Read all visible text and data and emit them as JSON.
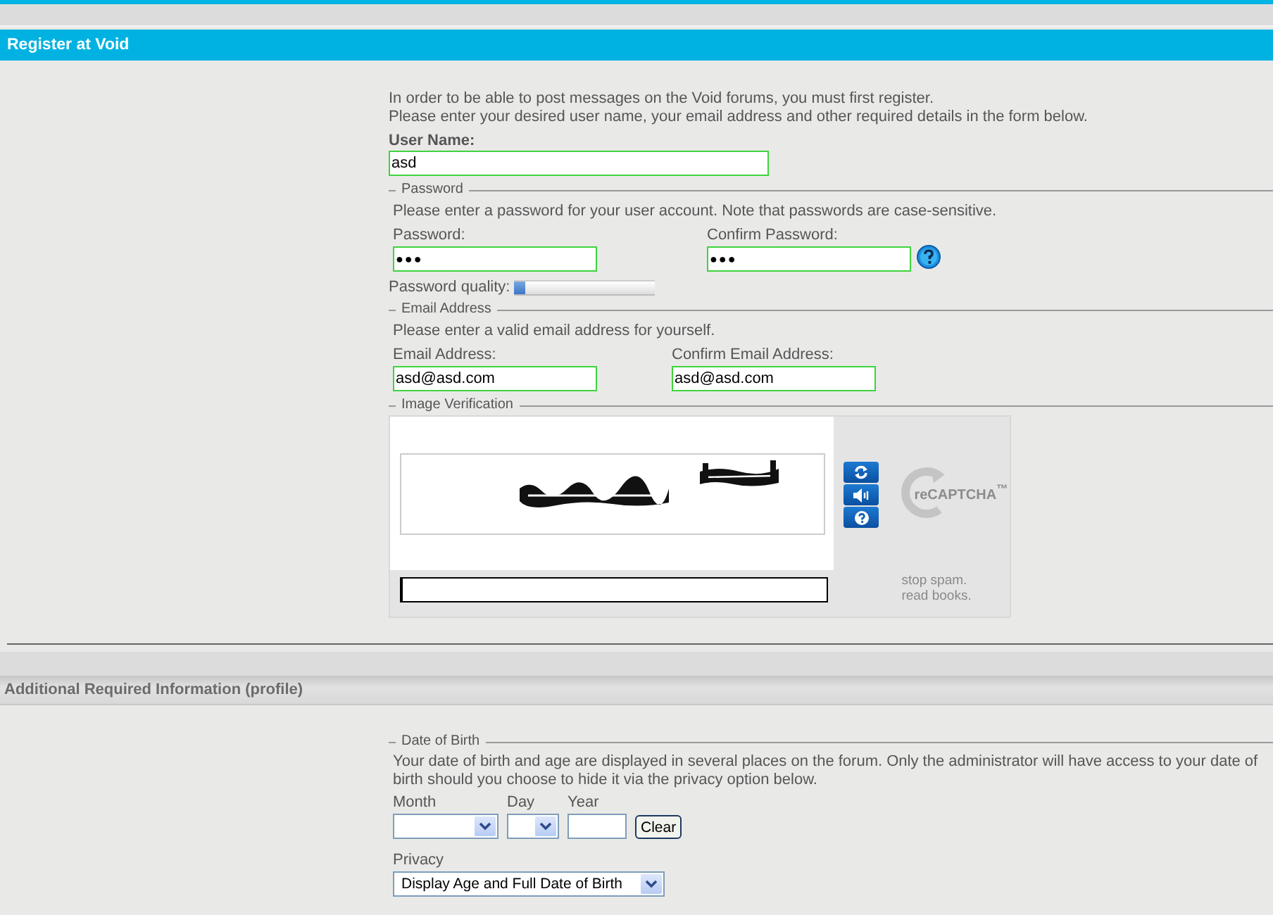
{
  "header": {
    "title": "Register at Void"
  },
  "intro": [
    "In order to be able to post messages on the Void forums, you must first register.",
    "Please enter your desired user name, your email address and other required details in the form below."
  ],
  "username": {
    "label": "User Name:",
    "value": "asd"
  },
  "password_section": {
    "legend": "Password",
    "note": "Please enter a password for your user account. Note that passwords are case-sensitive.",
    "password": {
      "label": "Password:",
      "value": "●●●"
    },
    "confirm": {
      "label": "Confirm Password:",
      "value": "●●●"
    },
    "quality": {
      "label": "Password quality:",
      "level": 0.08
    }
  },
  "email_section": {
    "legend": "Email Address",
    "note": "Please enter a valid email address for yourself.",
    "email": {
      "label": "Email Address:",
      "value": "asd@asd.com"
    },
    "confirm": {
      "label": "Confirm Email Address:",
      "value": "asd@asd.com"
    }
  },
  "verification": {
    "legend": "Image Verification",
    "logo": "reCAPTCHA$^{™}$",
    "tagline": [
      "stop spam.",
      "read books."
    ]
  },
  "profile": {
    "title": "Additional Required Information (profile)",
    "dob": {
      "legend": "Date of Birth",
      "note": "Your date of birth and age are displayed in several places on the forum. Only the administrator will have access to your date of birth should you choose to hide it via the privacy option below.",
      "month": {
        "label": "Month"
      },
      "day": {
        "label": "Day"
      },
      "year": {
        "label": "Year"
      },
      "clear": "Clear"
    },
    "privacy": {
      "label": "Privacy",
      "value": "Display Age and Full Date of Birth"
    }
  }
}
